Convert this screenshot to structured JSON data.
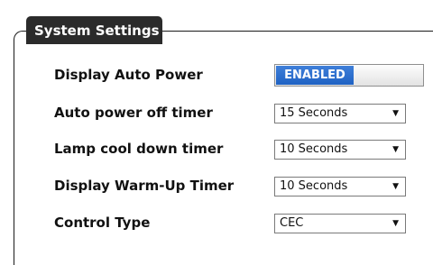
{
  "panel": {
    "title": "System Settings"
  },
  "settings": {
    "display_auto_power": {
      "label": "Display Auto Power",
      "value": "ENABLED"
    },
    "auto_power_off_timer": {
      "label": "Auto power off timer",
      "value": "15 Seconds"
    },
    "lamp_cool_down_timer": {
      "label": "Lamp cool down timer",
      "value": "10 Seconds"
    },
    "display_warm_up_timer": {
      "label": "Display Warm-Up Timer",
      "value": "10 Seconds"
    },
    "control_type": {
      "label": "Control Type",
      "value": "CEC"
    }
  },
  "icons": {
    "dropdown": "chevron-down-icon"
  },
  "colors": {
    "toggle_on": "#2a6fd1",
    "title_bar": "#2b2b2b"
  }
}
